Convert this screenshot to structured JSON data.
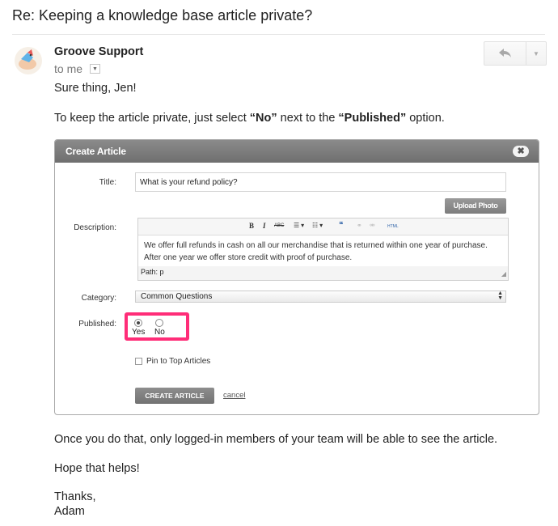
{
  "email": {
    "subject": "Re: Keeping a knowledge base article private?",
    "sender": "Groove Support",
    "recipient": "to me",
    "greeting": "Sure thing, Jen!",
    "instruction": {
      "prefix": "To keep the article private, just select ",
      "no_option": "“No”",
      "middle": " next to the ",
      "published_option": "“Published”",
      "suffix": " option."
    },
    "after_text": "Once you do that, only logged-in members of your team will be able to see the article.",
    "hope": "Hope that helps!",
    "signoff": "Thanks,",
    "signature": "Adam"
  },
  "dialog": {
    "title": "Create Article",
    "close_glyph": "✖",
    "title_label": "Title:",
    "title_value": "What is your refund policy?",
    "upload_label": "Upload Photo",
    "description_label": "Description:",
    "toolbar": {
      "bold": "B",
      "italic": "I",
      "strike": "ABC",
      "bullets": "☰ ▾",
      "numbers": "☷ ▾",
      "quote": "❝",
      "html": "HTML"
    },
    "description_value": "We offer full refunds in cash on all our merchandise that is returned within one year of purchase. After one year we offer store credit with proof of purchase.",
    "path_label": "Path: p",
    "category_label": "Category:",
    "category_value": "Common Questions",
    "published_label": "Published:",
    "published_options": [
      "Yes",
      "No"
    ],
    "published_selected": "Yes",
    "pin_label": "Pin to Top Articles",
    "create_label": "CREATE ARTICLE",
    "cancel_label": "cancel",
    "highlight_color": "#ff2d78"
  },
  "icons": {
    "avatar": "groove-bird-avatar",
    "reply": "reply-arrow-icon",
    "more": "chevron-down-icon"
  }
}
